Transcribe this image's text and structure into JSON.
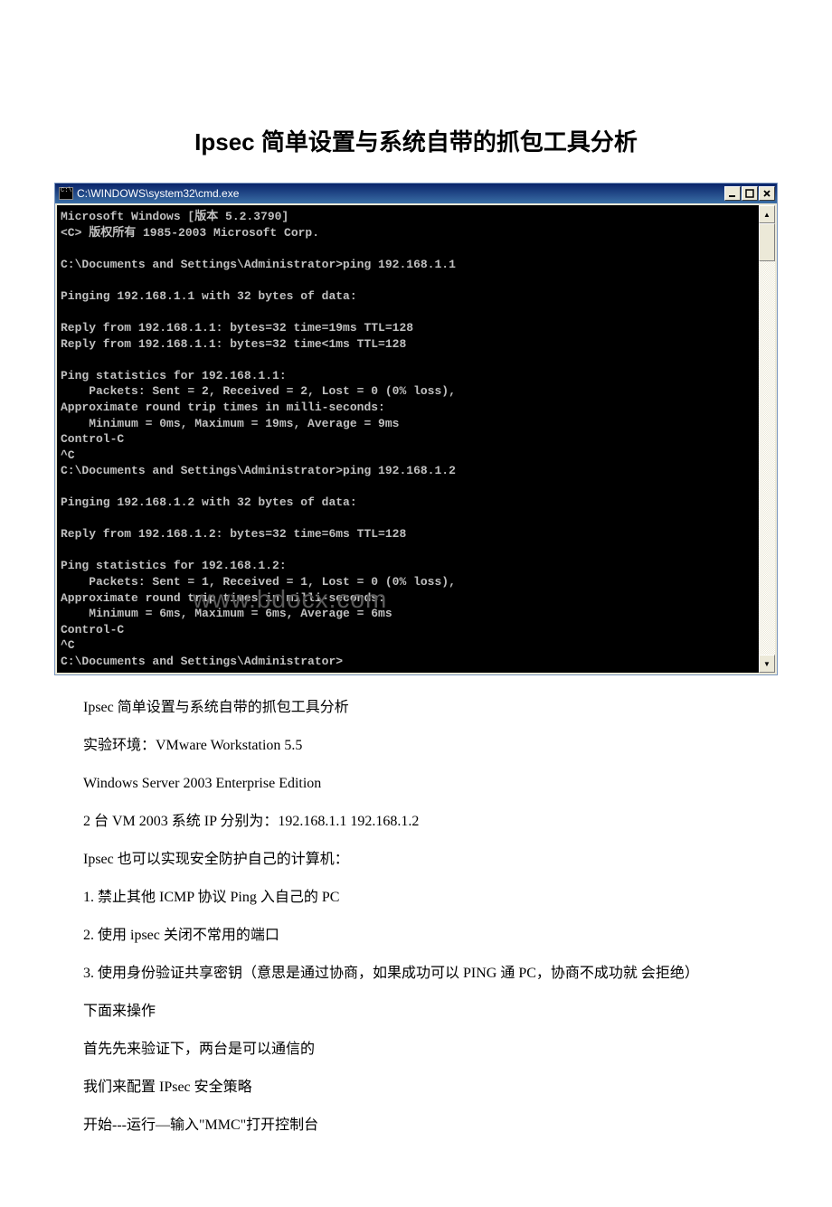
{
  "title": "Ipsec 简单设置与系统自带的抓包工具分析",
  "cmd": {
    "window_title": "C:\\WINDOWS\\system32\\cmd.exe",
    "lines": "Microsoft Windows [版本 5.2.3790]\n<C> 版权所有 1985-2003 Microsoft Corp.\n\nC:\\Documents and Settings\\Administrator>ping 192.168.1.1\n\nPinging 192.168.1.1 with 32 bytes of data:\n\nReply from 192.168.1.1: bytes=32 time=19ms TTL=128\nReply from 192.168.1.1: bytes=32 time<1ms TTL=128\n\nPing statistics for 192.168.1.1:\n    Packets: Sent = 2, Received = 2, Lost = 0 (0% loss),\nApproximate round trip times in milli-seconds:\n    Minimum = 0ms, Maximum = 19ms, Average = 9ms\nControl-C\n^C\nC:\\Documents and Settings\\Administrator>ping 192.168.1.2\n\nPinging 192.168.1.2 with 32 bytes of data:\n\nReply from 192.168.1.2: bytes=32 time=6ms TTL=128\n\nPing statistics for 192.168.1.2:\n    Packets: Sent = 1, Received = 1, Lost = 0 (0% loss),\nApproximate round trip times in milli-seconds:\n    Minimum = 6ms, Maximum = 6ms, Average = 6ms\nControl-C\n^C\nC:\\Documents and Settings\\Administrator>",
    "watermark": "www.bdocx.com"
  },
  "paragraphs": [
    "Ipsec 简单设置与系统自带的抓包工具分析",
    "实验环境：VMware Workstation 5.5",
    "Windows Server 2003 Enterprise Edition",
    "2 台 VM 2003 系统 IP 分别为：192.168.1.1 192.168.1.2",
    "Ipsec 也可以实现安全防护自己的计算机：",
    "1. 禁止其他 ICMP 协议 Ping 入自己的 PC",
    "2. 使用 ipsec 关闭不常用的端口",
    "3. 使用身份验证共享密钥（意思是通过协商，如果成功可以 PING 通 PC，协商不成功就 会拒绝）",
    "下面来操作",
    "首先先来验证下，两台是可以通信的",
    "我们来配置 IPsec 安全策略",
    "开始---运行—输入\"MMC\"打开控制台"
  ]
}
